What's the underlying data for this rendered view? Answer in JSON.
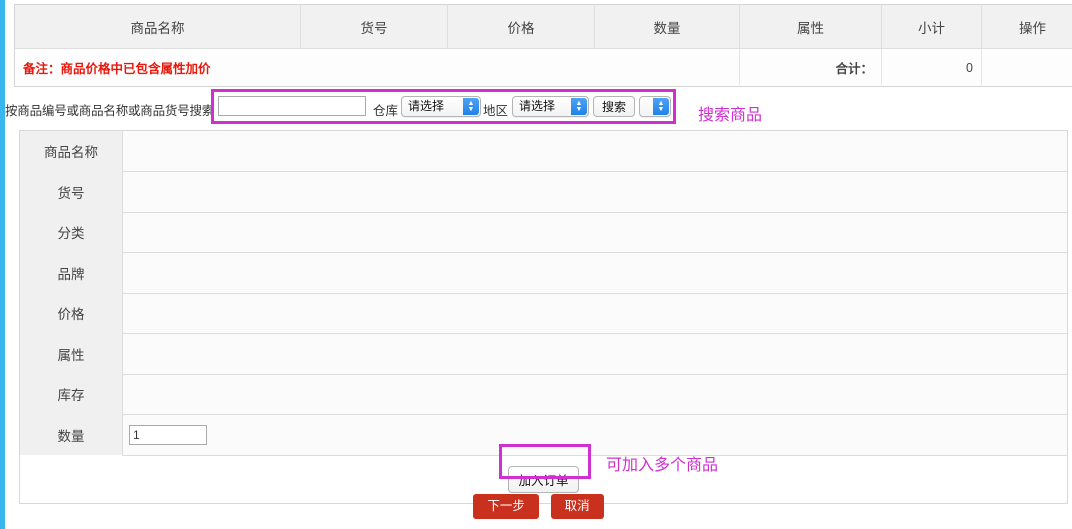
{
  "cart_table": {
    "columns": [
      "商品名称",
      "货号",
      "价格",
      "数量",
      "属性",
      "小计",
      "操作"
    ],
    "note": "备注：商品价格中已包含属性加价",
    "total_label": "合计：",
    "total_value": "0"
  },
  "search": {
    "label": "按商品编号或商品名称或商品货号搜索",
    "keyword_value": "",
    "keyword_placeholder": "",
    "warehouse_label": "仓库",
    "warehouse_value": "请选择",
    "region_label": "地区",
    "region_value": "请选择",
    "search_button": "搜索",
    "extra_select_value": ""
  },
  "detail": {
    "rows": [
      {
        "label": "商品名称",
        "value": ""
      },
      {
        "label": "货号",
        "value": ""
      },
      {
        "label": "分类",
        "value": ""
      },
      {
        "label": "品牌",
        "value": ""
      },
      {
        "label": "价格",
        "value": ""
      },
      {
        "label": "属性",
        "value": ""
      },
      {
        "label": "库存",
        "value": ""
      }
    ],
    "quantity_label": "数量",
    "quantity_value": "1",
    "add_button": "加入订单"
  },
  "footer": {
    "next_button": "下一步",
    "cancel_button": "取消"
  },
  "annotations": {
    "search_note": "搜索商品",
    "add_note": "可加入多个商品",
    "color": "#cf30cf"
  }
}
